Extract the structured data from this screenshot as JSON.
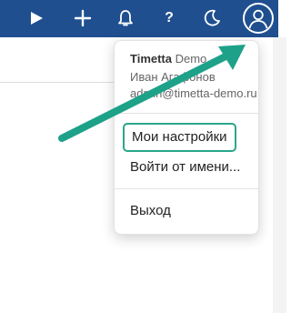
{
  "topbar": {
    "icons": [
      "play-icon",
      "plus-icon",
      "bell-icon",
      "help-icon",
      "moon-icon",
      "user-avatar-icon"
    ],
    "help_label": "?",
    "background": "#1f4f8f"
  },
  "user_menu": {
    "company_bold": "Timetta",
    "company_rest": " Demo",
    "user_name": "Иван Агафонов",
    "user_email": "admin@timetta-demo.ru",
    "items": [
      {
        "label": "Мои настройки",
        "highlighted": true
      },
      {
        "label": "Войти от имени..."
      },
      {
        "label": "Выход"
      }
    ],
    "highlight_color": "#2aa68c"
  },
  "annotation": {
    "arrow_color": "#1ea189"
  }
}
